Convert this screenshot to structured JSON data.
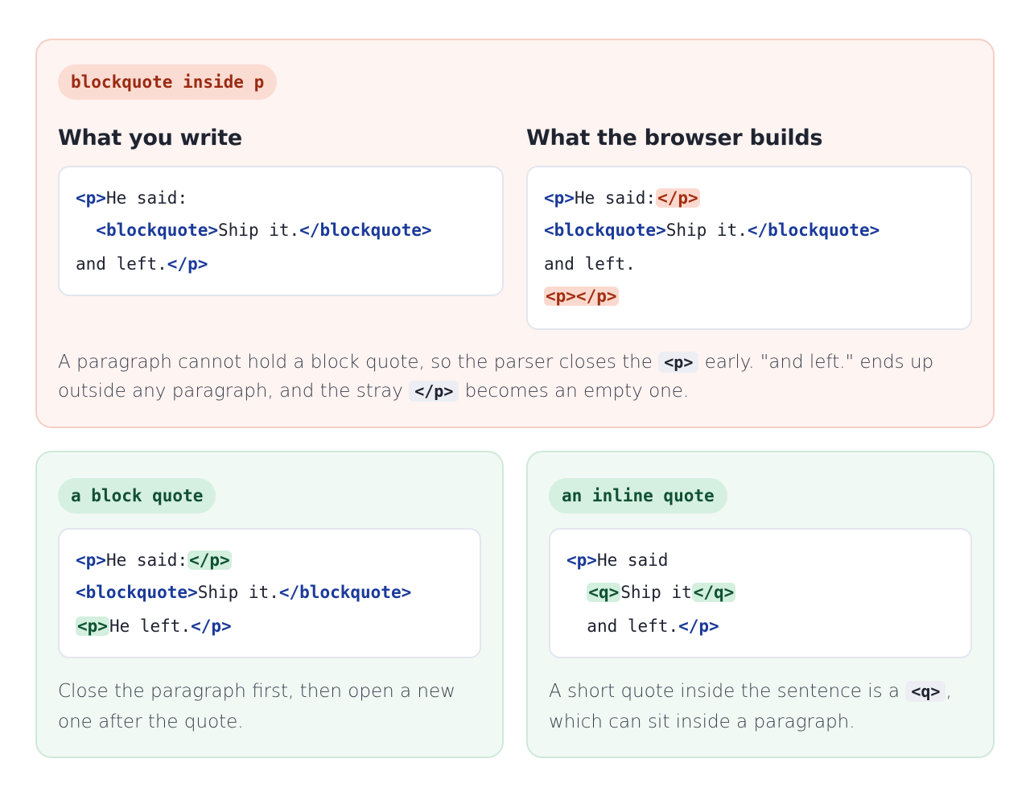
{
  "bad_example": {
    "tag": "blockquote inside p",
    "write_heading": "What you write",
    "builds_heading": "What the browser builds",
    "write_code": {
      "l1_open_p": "<p>",
      "l1_text": "He said:",
      "l2_indent": "  ",
      "l2_open_bq": "<blockquote>",
      "l2_text": "Ship it.",
      "l2_close_bq": "</blockquote>",
      "l3_text": "and left.",
      "l3_close_p": "</p>"
    },
    "builds_code": {
      "l1_open_p": "<p>",
      "l1_text": "He said:",
      "l1_close_p": "</p>",
      "l2_open_bq": "<blockquote>",
      "l2_text": "Ship it.",
      "l2_close_bq": "</blockquote>",
      "l3_text": "and left.",
      "l4_empty_p": "<p></p>"
    },
    "description": {
      "part1": "A paragraph cannot hold a block quote, so the parser closes the ",
      "code1": "<p>",
      "part2": " early. \"and left.\" ends up outside any paragraph, and the stray ",
      "code2": "</p>",
      "part3": " becomes an empty one."
    }
  },
  "block_quote_example": {
    "tag": "a block quote",
    "code": {
      "l1_open_p": "<p>",
      "l1_text": "He said:",
      "l1_close_p": "</p>",
      "l2_open_bq": "<blockquote>",
      "l2_text": "Ship it.",
      "l2_close_bq": "</blockquote>",
      "l3_open_p": "<p>",
      "l3_text": "He left.",
      "l3_close_p": "</p>"
    },
    "description": "Close the paragraph first, then open a new one after the quote."
  },
  "inline_quote_example": {
    "tag": "an inline quote",
    "code": {
      "l1_open_p": "<p>",
      "l1_text": "He said",
      "l2_indent": "  ",
      "l2_open_q": "<q>",
      "l2_text": "Ship it",
      "l2_close_q": "</q>",
      "l3_indent": "  ",
      "l3_text": "and left.",
      "l3_close_p": "</p>"
    },
    "description": {
      "part1": "A short quote inside the sentence is a ",
      "code1": "<q>",
      "part2": ", which can sit inside a paragraph."
    }
  },
  "colors": {
    "bad_bg": "#fef4f2",
    "bad_accent": "#a32e10",
    "good_bg": "#f1f9f4",
    "good_accent": "#0f5132",
    "tag_color": "#1a3a99"
  }
}
